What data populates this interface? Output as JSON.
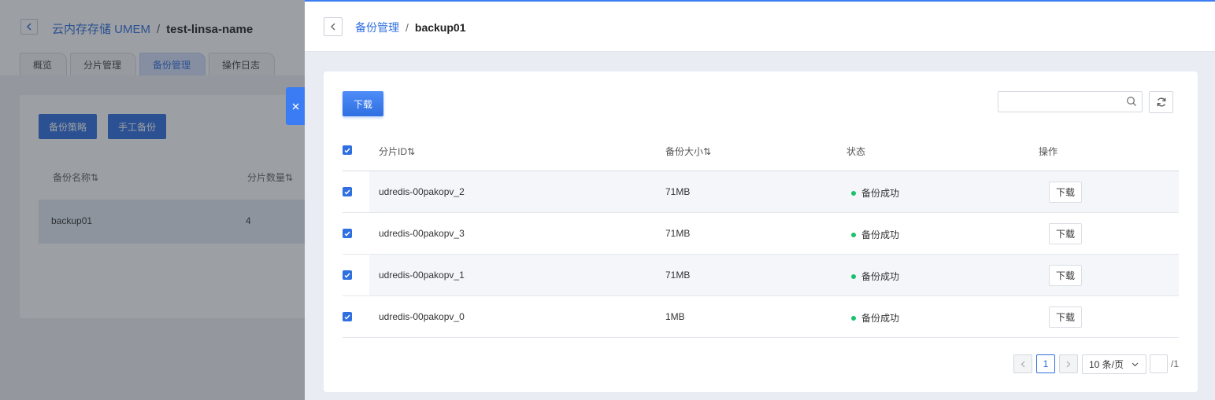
{
  "background": {
    "breadcrumb_link": "云内存存储 UMEM",
    "breadcrumb_sep": "/",
    "instance_name": "test-linsa-name",
    "tabs": [
      {
        "label": "概览"
      },
      {
        "label": "分片管理"
      },
      {
        "label": "备份管理"
      },
      {
        "label": "操作日志"
      }
    ],
    "buttons": {
      "policy": "备份策略",
      "manual": "手工备份"
    },
    "columns": {
      "name": "备份名称",
      "shards": "分片数量"
    },
    "row": {
      "name": "backup01",
      "shards": "4"
    }
  },
  "drawer": {
    "breadcrumb_link": "备份管理",
    "breadcrumb_sep": "/",
    "current": "backup01",
    "download_button": "下载",
    "search": {
      "value": "",
      "placeholder": ""
    },
    "columns": {
      "shard_id": "分片ID",
      "size": "备份大小",
      "status": "状态",
      "action": "操作"
    },
    "rows": [
      {
        "shard_id": "udredis-00pakopv_2",
        "size": "71MB",
        "status": "备份成功",
        "action": "下载"
      },
      {
        "shard_id": "udredis-00pakopv_3",
        "size": "71MB",
        "status": "备份成功",
        "action": "下载"
      },
      {
        "shard_id": "udredis-00pakopv_1",
        "size": "71MB",
        "status": "备份成功",
        "action": "下载"
      },
      {
        "shard_id": "udredis-00pakopv_0",
        "size": "1MB",
        "status": "备份成功",
        "action": "下载"
      }
    ],
    "pagination": {
      "current_page": "1",
      "page_size": "10 条/页",
      "total": "/1"
    }
  },
  "colors": {
    "accent": "#2f6fe0",
    "success": "#19c36b"
  },
  "icons": {
    "back": "chevron-left-icon",
    "close": "close-icon",
    "search": "search-icon",
    "refresh": "refresh-icon",
    "sort": "sort-icon",
    "checkbox": "checkbox-checked-icon"
  }
}
